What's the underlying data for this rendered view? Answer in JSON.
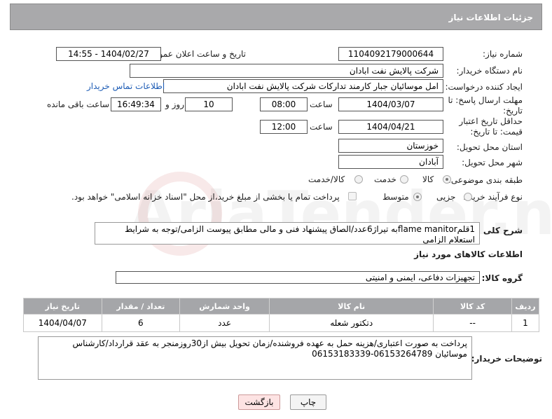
{
  "header": {
    "title": "جزئیات اطلاعات نیاز"
  },
  "fields": {
    "need_number_label": "شماره نیاز:",
    "need_number": "1104092179000644",
    "announce_label": "تاریخ و ساعت اعلان عمومی:",
    "announce_value": "1404/02/27 - 14:55",
    "buyer_org_label": "نام دستگاه خریدار:",
    "buyer_org": "شرکت پالایش نفت ابادان",
    "creator_label": "ایجاد کننده درخواست:",
    "creator": "امل موسائیان جبار کارمند تدارکات شرکت پالایش نفت ابادان",
    "buyer_contact_link": "اطلاعات تماس خریدار",
    "deadline_label": "مهلت ارسال پاسخ: تا تاریخ:",
    "deadline_date": "1404/03/07",
    "time_label": "ساعت",
    "deadline_time": "08:00",
    "days_value": "10",
    "days_label": "روز و",
    "remaining_time": "16:49:34",
    "remaining_label": "ساعت باقی مانده",
    "validity_label": "حداقل تاریخ اعتبار قیمت: تا تاریخ:",
    "validity_date": "1404/04/21",
    "validity_time_label": "ساعت",
    "validity_time": "12:00",
    "province_label": "استان محل تحویل:",
    "province": "خوزستان",
    "city_label": "شهر محل تحویل:",
    "city": "آبادان",
    "category_label": "طبقه بندی موضوعی:",
    "category_options": [
      "کالا",
      "خدمت",
      "کالا/خدمت"
    ],
    "process_label": "نوع فرآیند خرید :",
    "process_options": [
      "جزیی",
      "متوسط"
    ],
    "process_note": "پرداخت تمام یا بخشی از مبلغ خرید،از محل \"اسناد خزانه اسلامی\" خواهد بود.",
    "summary_label": "شرح کلی نیاز:",
    "summary": "1قلمflame manitorبه تیراژ6عدد/الصاق پیشنهاد فنی و مالی مطابق پیوست الزامی/توجه به شرایط استعلام الزامی",
    "goods_info_title": "اطلاعات کالاهای مورد نیاز",
    "goods_group_label": "گروه کالا:",
    "goods_group": "تجهیزات دفاعی، ایمنی و امنیتی",
    "buyer_notes_label": "توضیحات خریدار:",
    "buyer_notes": "پرداخت به صورت اعتباری/هزینه حمل به عهده فروشنده/زمان تحویل بیش از30روزمنجر به عقد قرارداد/کارشناس موسائیان 06153264789-06153183339"
  },
  "table": {
    "headers": [
      "ردیف",
      "کد کالا",
      "نام کالا",
      "واحد شمارش",
      "تعداد / مقدار",
      "تاریخ نیاز"
    ],
    "rows": [
      [
        "1",
        "--",
        "دتکتور شعله",
        "عدد",
        "6",
        "1404/04/07"
      ]
    ]
  },
  "buttons": {
    "print": "چاپ",
    "back": "بازگشت"
  },
  "watermark": {
    "text": "AriaTender.neT"
  },
  "colors": {
    "header_bg": "#a9a9ab",
    "link": "#1d5cb5",
    "back_button_bg": "#fde3e3"
  }
}
